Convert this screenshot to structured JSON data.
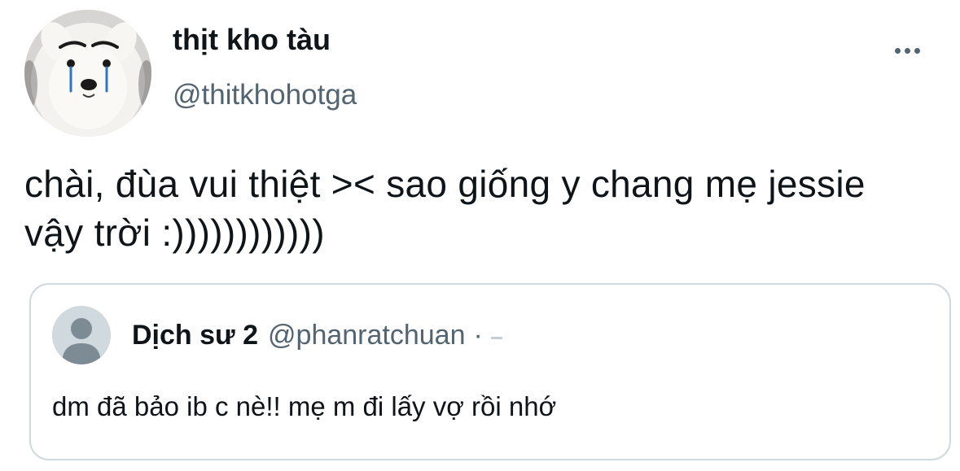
{
  "tweet": {
    "author": {
      "display_name": "thịt kho tàu",
      "handle": "@thitkhohotga",
      "avatar_icon": "crying-samoyed-avatar"
    },
    "more_icon": "more-dots-icon",
    "text": "chài, đùa vui thiệt >< sao giống y chang mẹ jessie vậy trời :))))))))))))",
    "quoted": {
      "author": {
        "display_name": "Dịch sư 2",
        "handle": "@phanratchuan",
        "separator": "·",
        "avatar_icon": "default-user-avatar"
      },
      "text": "dm đã bảo ib c nè!! mẹ m đi lấy vợ rồi nhớ"
    }
  },
  "colors": {
    "text_primary": "#0f1419",
    "text_secondary": "#536471",
    "border": "#cfd9de"
  }
}
